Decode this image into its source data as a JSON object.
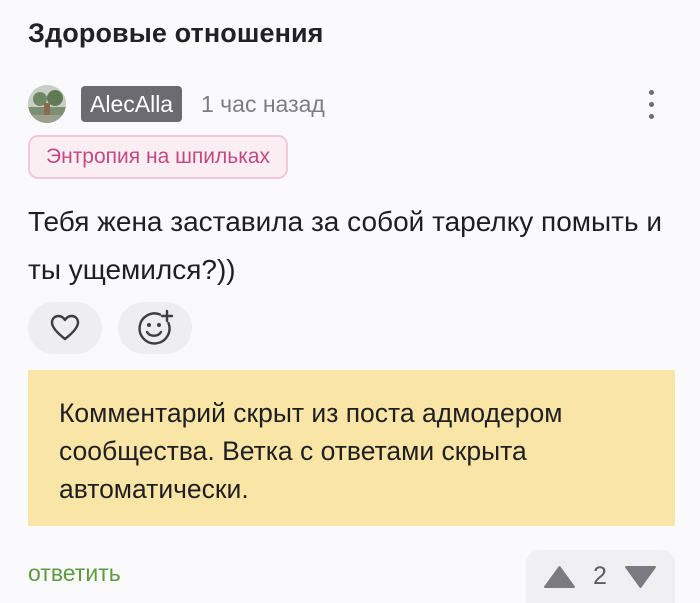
{
  "post": {
    "title": "Здоровые отношения"
  },
  "comment": {
    "author": "AlecAlla",
    "time": "1 час назад",
    "community": "Энтропия на шпильках",
    "text": "Тебя жена заставила за собой тарелку помыть и ты ущемился?))",
    "hidden_notice": "Комментарий скрыт из поста адмодером сообщества. Ветка с ответами скрыта автоматически.",
    "reply_label": "ответить",
    "rating": "2"
  },
  "icons": {
    "more": "more-vertical-icon",
    "like": "heart-icon",
    "reaction": "add-emoji-icon",
    "upvote": "triangle-up-icon",
    "downvote": "triangle-down-icon"
  },
  "colors": {
    "background": "#fafafd",
    "author_badge": "#6b6b70",
    "community_text": "#c24a81",
    "community_border": "#f3c9d9",
    "notice_bg": "#f9e6a7",
    "reply_link": "#5d9a3f"
  }
}
